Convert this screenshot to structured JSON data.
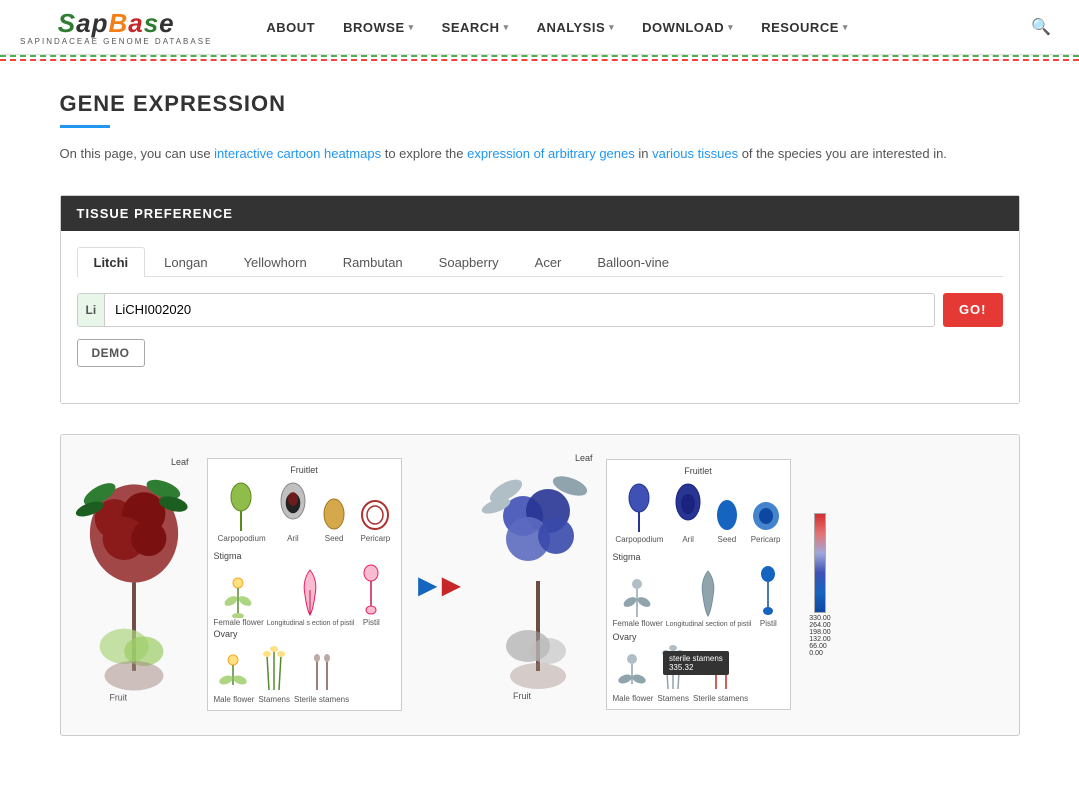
{
  "brand": {
    "name_part1": "Sap",
    "name_part2": "Base",
    "subtitle": "SAPindaceae Genome dataBase"
  },
  "navbar": {
    "items": [
      {
        "label": "ABOUT",
        "has_dropdown": false
      },
      {
        "label": "BROWSE",
        "has_dropdown": true
      },
      {
        "label": "SEARCH",
        "has_dropdown": true
      },
      {
        "label": "ANALYSIS",
        "has_dropdown": true
      },
      {
        "label": "DOWNLOAD",
        "has_dropdown": true
      },
      {
        "label": "RESOURCE",
        "has_dropdown": true
      }
    ]
  },
  "page": {
    "title": "GENE EXPRESSION",
    "description": "On this page, you can use interactive cartoon heatmaps to explore the expression of arbitrary genes in various tissues of the species you are interested in."
  },
  "tissue_panel": {
    "header": "TISSUE PREFERENCE",
    "tabs": [
      {
        "label": "Litchi",
        "active": true
      },
      {
        "label": "Longan"
      },
      {
        "label": "Yellowhorn"
      },
      {
        "label": "Rambutan"
      },
      {
        "label": "Soapberry"
      },
      {
        "label": "Acer"
      },
      {
        "label": "Balloon-vine"
      }
    ],
    "input": {
      "badge": "Li",
      "placeholder": "LiCHI002020",
      "value": "LiCHI002020"
    },
    "go_button": "GO!",
    "demo_button": "DEMO"
  },
  "heatmap": {
    "left_labels": {
      "leaf": "Leaf",
      "fruit": "Fruit"
    },
    "right_labels": {
      "leaf": "Leaf",
      "fruit": "Fruit"
    },
    "tissues_top": [
      "Carpopodium",
      "Aril",
      "Seed",
      "Pericarp"
    ],
    "tissues_bottom_left": [
      "Female flower",
      "Longitudinal section of pistil",
      "Pistil"
    ],
    "tissues_bottom_right": [
      "Male flower",
      "Stamens",
      "Sterile stamens"
    ],
    "fruitlet_left": "Fruitlet",
    "fruitlet_right": "Fruitlet",
    "stigma": "Stigma",
    "ovary": "Ovary",
    "color_legend": {
      "values": [
        "330.00",
        "264.00",
        "198.00",
        "132.00",
        "66.00",
        "0.00"
      ]
    },
    "tooltip": {
      "label": "sterile stamens",
      "value": "335.32"
    }
  }
}
